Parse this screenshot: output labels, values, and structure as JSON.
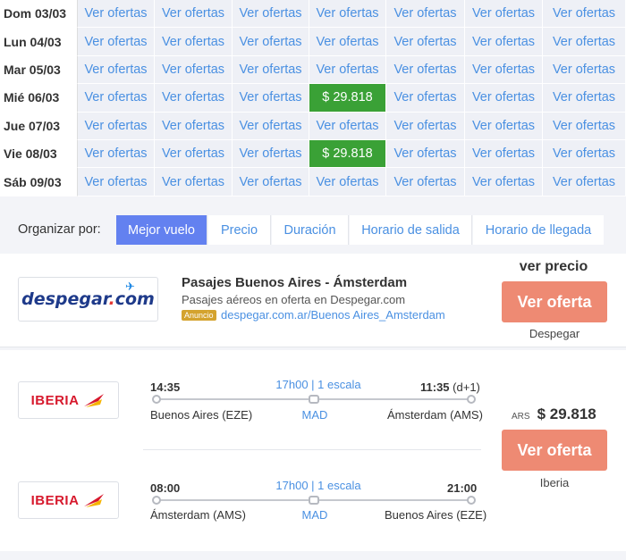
{
  "date_grid": {
    "rows": [
      {
        "label": "Dom 03/03",
        "cells": [
          "Ver ofertas",
          "Ver ofertas",
          "Ver ofertas",
          "Ver ofertas",
          "Ver ofertas",
          "Ver ofertas",
          "Ver ofertas"
        ]
      },
      {
        "label": "Lun 04/03",
        "cells": [
          "Ver ofertas",
          "Ver ofertas",
          "Ver ofertas",
          "Ver ofertas",
          "Ver ofertas",
          "Ver ofertas",
          "Ver ofertas"
        ]
      },
      {
        "label": "Mar 05/03",
        "cells": [
          "Ver ofertas",
          "Ver ofertas",
          "Ver ofertas",
          "Ver ofertas",
          "Ver ofertas",
          "Ver ofertas",
          "Ver ofertas"
        ]
      },
      {
        "label": "Mié 06/03",
        "cells": [
          "Ver ofertas",
          "Ver ofertas",
          "Ver ofertas",
          "$ 29.818",
          "Ver ofertas",
          "Ver ofertas",
          "Ver ofertas"
        ]
      },
      {
        "label": "Jue 07/03",
        "cells": [
          "Ver ofertas",
          "Ver ofertas",
          "Ver ofertas",
          "Ver ofertas",
          "Ver ofertas",
          "Ver ofertas",
          "Ver ofertas"
        ]
      },
      {
        "label": "Vie 08/03",
        "cells": [
          "Ver ofertas",
          "Ver ofertas",
          "Ver ofertas",
          "$ 29.818",
          "Ver ofertas",
          "Ver ofertas",
          "Ver ofertas"
        ]
      },
      {
        "label": "Sáb 09/03",
        "cells": [
          "Ver ofertas",
          "Ver ofertas",
          "Ver ofertas",
          "Ver ofertas",
          "Ver ofertas",
          "Ver ofertas",
          "Ver ofertas"
        ]
      }
    ]
  },
  "sort": {
    "label": "Organizar por:",
    "tabs": [
      {
        "label": "Mejor vuelo",
        "active": true
      },
      {
        "label": "Precio",
        "active": false
      },
      {
        "label": "Duración",
        "active": false
      },
      {
        "label": "Horario de salida",
        "active": false
      },
      {
        "label": "Horario de llegada",
        "active": false
      }
    ]
  },
  "ad": {
    "logo_text": "despegar",
    "logo_suffix": "com",
    "title": "Pasajes Buenos Aires - Ámsterdam",
    "subtitle": "Pasajes aéreos en oferta en Despegar.com",
    "badge": "Anuncio",
    "link": "despegar.com.ar/Buenos Aires_Amsterdam",
    "cta_top": "ver precio",
    "cta_button": "Ver oferta",
    "provider": "Despegar"
  },
  "flight": {
    "airline": "IBERIA",
    "outbound": {
      "depart_time": "14:35",
      "arrive_time": "11:35",
      "arrive_offset": "(d+1)",
      "duration": "17h00 | 1 escala",
      "from": "Buenos Aires (EZE)",
      "stop": "MAD",
      "to": "Ámsterdam (AMS)"
    },
    "inbound": {
      "depart_time": "08:00",
      "arrive_time": "21:00",
      "duration": "17h00 | 1 escala",
      "from": "Ámsterdam (AMS)",
      "stop": "MAD",
      "to": "Buenos Aires (EZE)"
    },
    "currency": "ARS",
    "price": "$ 29.818",
    "cta_button": "Ver oferta",
    "provider": "Iberia"
  },
  "colors": {
    "link_blue": "#4a90e2",
    "price_green": "#3aa136",
    "active_tab": "#6381f0",
    "cta_salmon": "#ee8a73",
    "iberia_red": "#d7192d"
  }
}
